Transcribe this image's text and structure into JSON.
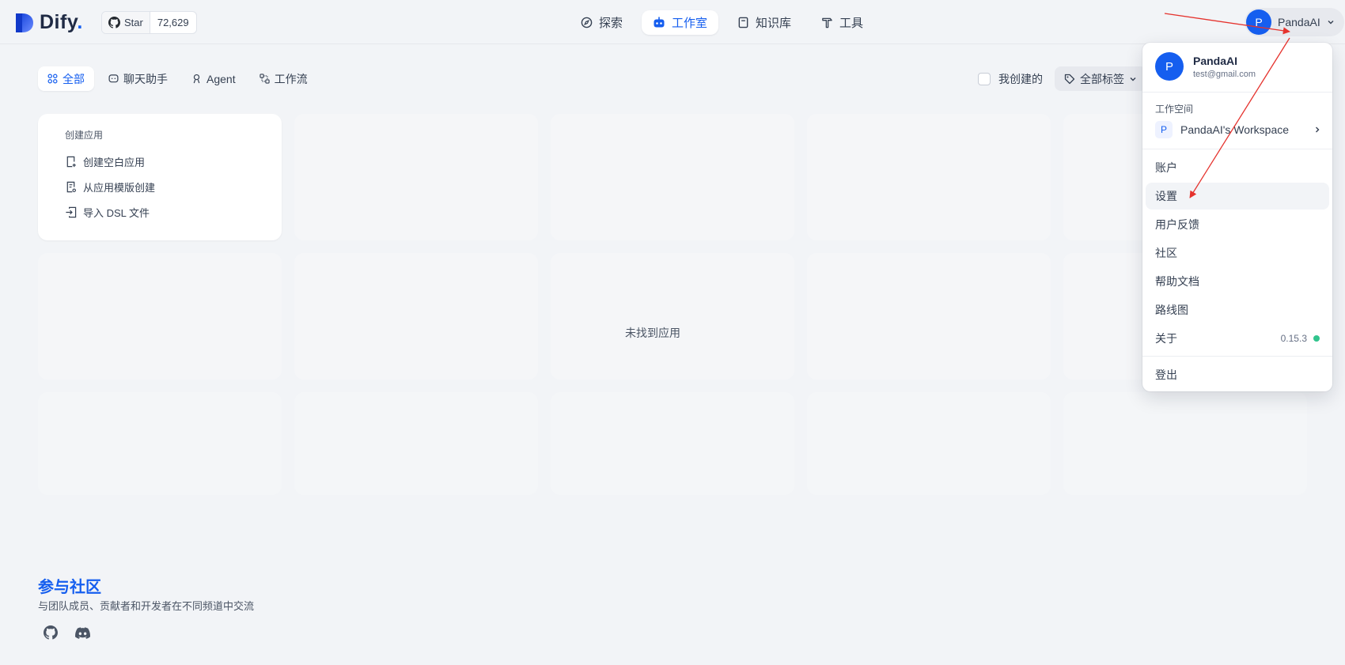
{
  "brand": {
    "name": "Dify",
    "name_dot": "."
  },
  "github": {
    "star_label": "Star",
    "star_count": "72,629"
  },
  "nav": {
    "items": [
      {
        "label": "探索",
        "icon": "compass-icon"
      },
      {
        "label": "工作室",
        "icon": "robot-icon",
        "active": true
      },
      {
        "label": "知识库",
        "icon": "book-icon"
      },
      {
        "label": "工具",
        "icon": "hammer-icon"
      }
    ]
  },
  "user": {
    "initial": "P",
    "name": "PandaAI"
  },
  "filters": {
    "tabs": [
      {
        "label": "全部",
        "icon": "grid-icon",
        "active": true
      },
      {
        "label": "聊天助手",
        "icon": "chat-icon"
      },
      {
        "label": "Agent",
        "icon": "agent-icon"
      },
      {
        "label": "工作流",
        "icon": "workflow-icon"
      }
    ],
    "mine_label": "我创建的",
    "tag_label": "全部标签"
  },
  "create": {
    "title": "创建应用",
    "items": [
      {
        "label": "创建空白应用",
        "icon": "file-plus-icon"
      },
      {
        "label": "从应用模版创建",
        "icon": "file-template-icon"
      },
      {
        "label": "导入 DSL 文件",
        "icon": "import-icon"
      }
    ]
  },
  "empty_text": "未找到应用",
  "community": {
    "title": "参与社区",
    "subtitle": "与团队成员、贡献者和开发者在不同频道中交流"
  },
  "menu": {
    "name": "PandaAI",
    "email": "test@gmail.com",
    "workspace_label": "工作空间",
    "workspace_initial": "P",
    "workspace_name": "PandaAI's Workspace",
    "items": [
      "账户",
      "设置",
      "用户反馈",
      "社区",
      "帮助文档",
      "路线图",
      "关于"
    ],
    "version": "0.15.3",
    "logout": "登出"
  },
  "colors": {
    "accent": "#155eef",
    "status_ok": "#31c48d",
    "annotation": "#e5322d"
  }
}
